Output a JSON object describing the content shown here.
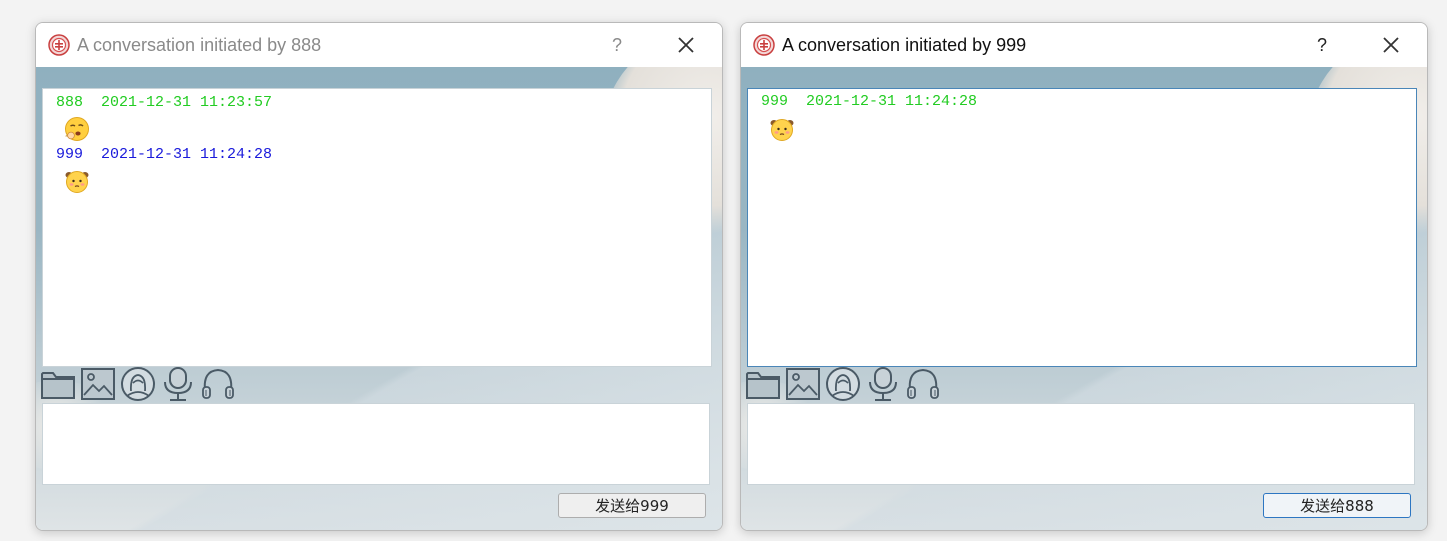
{
  "windows": [
    {
      "title": "A conversation initiated by 888",
      "help_label": "?",
      "messages": [
        {
          "sender": "888",
          "timestamp": "2021-12-31 11:23:57",
          "color": "#22cc22",
          "emoji": "dozing-face"
        },
        {
          "sender": "999",
          "timestamp": "2021-12-31 11:24:28",
          "color": "#1a1adb",
          "emoji": "shy-face"
        }
      ],
      "input_value": "",
      "send_label": "发送给999"
    },
    {
      "title": "A conversation initiated by 999",
      "help_label": "?",
      "messages": [
        {
          "sender": "999",
          "timestamp": "2021-12-31 11:24:28",
          "color": "#22cc22",
          "emoji": "shy-face"
        }
      ],
      "input_value": "",
      "send_label": "发送给888"
    }
  ],
  "toolbar_icons": [
    "folder-icon",
    "image-icon",
    "video-call-icon",
    "microphone-icon",
    "headset-icon"
  ],
  "colors": {
    "accent_blue": "#2d76c2",
    "green_text": "#22cc22",
    "blue_text": "#1a1adb"
  }
}
